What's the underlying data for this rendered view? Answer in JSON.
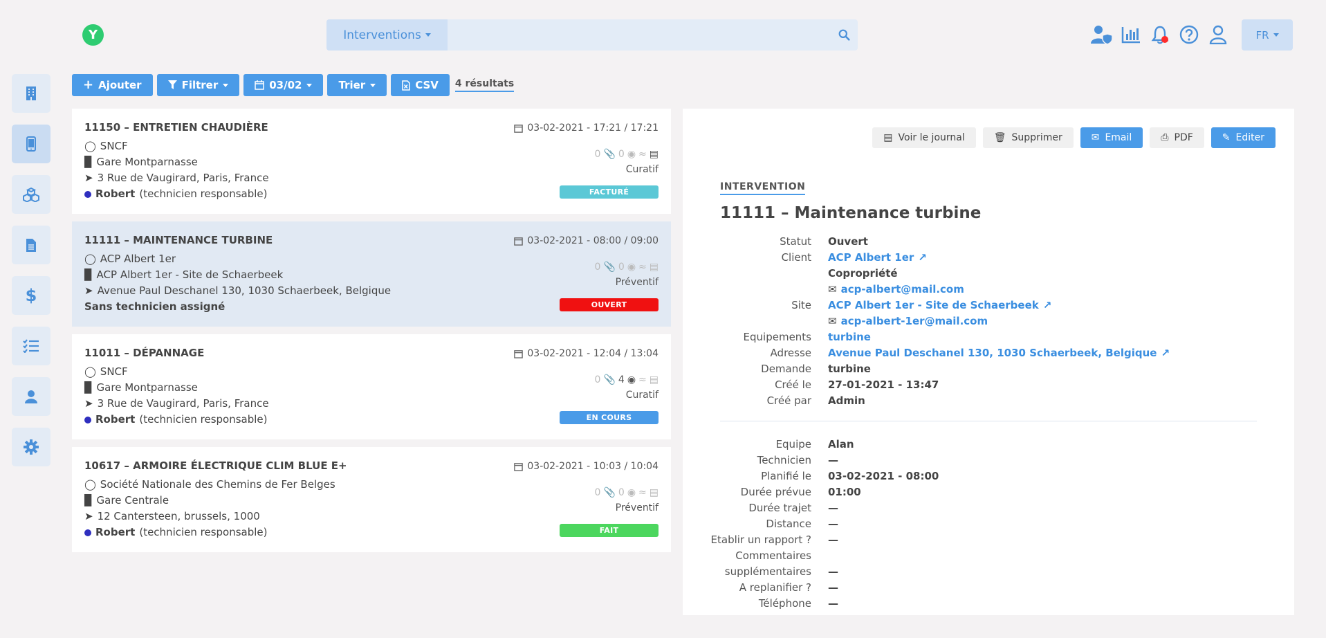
{
  "header": {
    "logo_letter": "Y",
    "search_module": "Interventions",
    "search_placeholder": "",
    "lang": "FR"
  },
  "toolbar": {
    "add": "Ajouter",
    "filter": "Filtrer",
    "date": "03/02",
    "sort": "Trier",
    "csv": "CSV",
    "results": "4 résultats"
  },
  "cards": [
    {
      "title": "11150 – ENTRETIEN CHAUDIÈRE",
      "date": "03-02-2021 - 17:21 / 17:21",
      "client": "SNCF",
      "site": "Gare Montparnasse",
      "address": "3 Rue de Vaugirard, Paris, France",
      "tech_name": "Robert",
      "tech_role": "(technicien responsable)",
      "attachments": "0",
      "photos": "0",
      "type": "Curatif",
      "status": "FACTURÉ",
      "status_color": "#5bc8d6"
    },
    {
      "title": "11111 – MAINTENANCE TURBINE",
      "date": "03-02-2021 - 08:00 / 09:00",
      "client": "ACP Albert 1er",
      "site": "ACP Albert 1er - Site de Schaerbeek",
      "address": "Avenue Paul Deschanel 130, 1030 Schaerbeek, Belgique",
      "tech_none": "Sans technicien assigné",
      "attachments": "0",
      "photos": "0",
      "type": "Préventif",
      "status": "OUVERT",
      "status_color": "#f01111"
    },
    {
      "title": "11011 – DÉPANNAGE",
      "date": "03-02-2021 - 12:04 / 13:04",
      "client": "SNCF",
      "site": "Gare Montparnasse",
      "address": "3 Rue de Vaugirard, Paris, France",
      "tech_name": "Robert",
      "tech_role": "(technicien responsable)",
      "attachments": "0",
      "photos": "4",
      "type": "Curatif",
      "status": "EN COURS",
      "status_color": "#4a9be8"
    },
    {
      "title": "10617 – ARMOIRE ÉLECTRIQUE CLIM BLUE E+",
      "date": "03-02-2021 - 10:03 / 10:04",
      "client": "Société Nationale des Chemins de Fer Belges",
      "site": "Gare Centrale",
      "address": "12 Cantersteen, brussels, 1000",
      "tech_name": "Robert",
      "tech_role": "(technicien responsable)",
      "attachments": "0",
      "photos": "0",
      "type": "Préventif",
      "status": "FAIT",
      "status_color": "#4cd65e"
    }
  ],
  "detail": {
    "buttons": {
      "journal": "Voir le journal",
      "delete": "Supprimer",
      "email": "Email",
      "pdf": "PDF",
      "edit": "Editer"
    },
    "section": "INTERVENTION",
    "title": "11111 – Maintenance turbine",
    "fields": {
      "statut_label": "Statut",
      "statut": "Ouvert",
      "client_label": "Client",
      "client": "ACP Albert 1er",
      "client_type": "Copropriété",
      "client_email": "acp-albert@mail.com",
      "site_label": "Site",
      "site": "ACP Albert 1er - Site de Schaerbeek",
      "site_email": "acp-albert-1er@mail.com",
      "equip_label": "Equipements",
      "equip": "turbine",
      "adresse_label": "Adresse",
      "adresse": "Avenue Paul Deschanel 130, 1030 Schaerbeek, Belgique",
      "demande_label": "Demande",
      "demande": "turbine",
      "cree_le_label": "Créé le",
      "cree_le": "27-01-2021 - 13:47",
      "cree_par_label": "Créé par",
      "cree_par": "Admin"
    },
    "fields2": {
      "equipe_label": "Equipe",
      "equipe": "Alan",
      "technicien_label": "Technicien",
      "technicien": "—",
      "planifie_label": "Planifié le",
      "planifie": "03-02-2021 - 08:00",
      "duree_label": "Durée prévue",
      "duree": "01:00",
      "trajet_label": "Durée trajet",
      "trajet": "—",
      "distance_label": "Distance",
      "distance": "—",
      "rapport_label": "Etablir un rapport ?",
      "rapport": "—",
      "comm_label_1": "Commentaires",
      "comm_label_2": "supplémentaires",
      "comm": "—",
      "replan_label": "A replanifier ?",
      "replan": "—",
      "tel_label": "Téléphone",
      "tel": "—"
    }
  },
  "colors": {
    "accent": "#4a9be8",
    "link": "#3a8ee0",
    "selected_card": "#e1e9f3"
  }
}
